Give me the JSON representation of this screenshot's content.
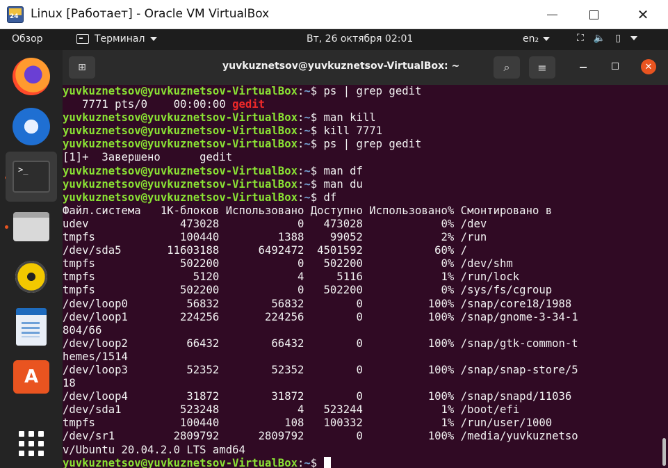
{
  "host": {
    "title": "Linux [Работает] - Oracle VM VirtualBox",
    "icon_label": "24"
  },
  "panel": {
    "activities": "Обзор",
    "app_name": "Терминал",
    "clock": "Вт, 26 октября  02:01",
    "lang": "en₂",
    "tray_icons": [
      "network-icon",
      "volume-icon",
      "battery-icon",
      "chevron-down-icon"
    ]
  },
  "dock": {
    "apps": [
      "firefox-icon",
      "thunderbird-icon",
      "terminal-icon",
      "files-icon",
      "rhythmbox-icon",
      "libreoffice-writer-icon",
      "ubuntu-software-icon",
      "show-applications-icon"
    ]
  },
  "terminal": {
    "title": "yuvkuznetsov@yuvkuznetsov-VirtualBox: ~",
    "prompt_user": "yuvkuznetsov@yuvkuznetsov-VirtualBox",
    "prompt_path": "~",
    "commands": {
      "c1": "ps | grep gedit",
      "c2": "man kill",
      "c3": "kill 7771",
      "c4": "ps | grep gedit",
      "c5": "man df",
      "c6": "man du",
      "c7": "df"
    },
    "ps_result_prefix": "   7771 pts/0    00:00:00 ",
    "ps_result_match": "gedit",
    "job_done": "[1]+  Завершено      gedit",
    "df_header": "Файл.система   1K-блоков Использовано Доступно Использовано% Смонтировано в",
    "df_rows": [
      "udev              473028            0   473028            0% /dev",
      "tmpfs             100440         1388    99052            2% /run",
      "/dev/sda5       11603188      6492472  4501592           60% /",
      "tmpfs             502200            0   502200            0% /dev/shm",
      "tmpfs               5120            4     5116            1% /run/lock",
      "tmpfs             502200            0   502200            0% /sys/fs/cgroup",
      "/dev/loop0         56832        56832        0          100% /snap/core18/1988",
      "/dev/loop1        224256       224256        0          100% /snap/gnome-3-34-1",
      "804/66",
      "/dev/loop2         66432        66432        0          100% /snap/gtk-common-t",
      "hemes/1514",
      "/dev/loop3         52352        52352        0          100% /snap/snap-store/5",
      "18",
      "/dev/loop4         31872        31872        0          100% /snap/snapd/11036",
      "/dev/sda1         523248            4   523244            1% /boot/efi",
      "tmpfs             100440          108   100332            1% /run/user/1000",
      "/dev/sr1         2809792      2809792        0          100% /media/yuvkuznetso",
      "v/Ubuntu 20.04.2.0 LTS amd64"
    ]
  }
}
